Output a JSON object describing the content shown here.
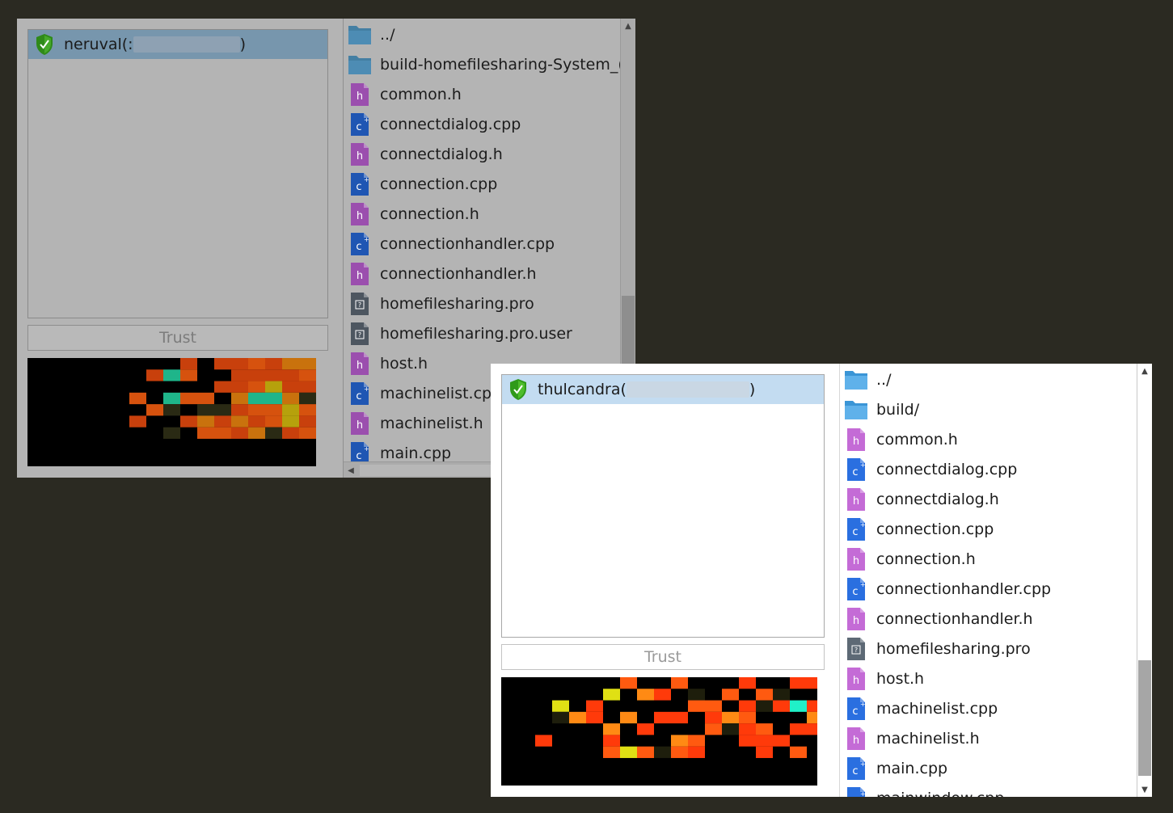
{
  "windows": [
    {
      "id": "back",
      "machine": {
        "name": "neruval",
        "prefix": " (:",
        "suffix": ")"
      },
      "trust_label": "Trust",
      "files": [
        {
          "name": "../",
          "type": "folder"
        },
        {
          "name": "build-homefilesharing-System_(",
          "type": "folder"
        },
        {
          "name": "common.h",
          "type": "header"
        },
        {
          "name": "connectdialog.cpp",
          "type": "cpp"
        },
        {
          "name": "connectdialog.h",
          "type": "header"
        },
        {
          "name": "connection.cpp",
          "type": "cpp"
        },
        {
          "name": "connection.h",
          "type": "header"
        },
        {
          "name": "connectionhandler.cpp",
          "type": "cpp"
        },
        {
          "name": "connectionhandler.h",
          "type": "header"
        },
        {
          "name": "homefilesharing.pro",
          "type": "pro"
        },
        {
          "name": "homefilesharing.pro.user",
          "type": "pro"
        },
        {
          "name": "host.h",
          "type": "header"
        },
        {
          "name": "machinelist.cpp",
          "type": "cpp"
        },
        {
          "name": "machinelist.h",
          "type": "header"
        },
        {
          "name": "main.cpp",
          "type": "cpp"
        }
      ]
    },
    {
      "id": "front",
      "machine": {
        "name": "thulcandra",
        "prefix": " (",
        "suffix": ")"
      },
      "trust_label": "Trust",
      "files": [
        {
          "name": "../",
          "type": "folder"
        },
        {
          "name": "build/",
          "type": "folder"
        },
        {
          "name": "common.h",
          "type": "header"
        },
        {
          "name": "connectdialog.cpp",
          "type": "cpp"
        },
        {
          "name": "connectdialog.h",
          "type": "header"
        },
        {
          "name": "connection.cpp",
          "type": "cpp"
        },
        {
          "name": "connection.h",
          "type": "header"
        },
        {
          "name": "connectionhandler.cpp",
          "type": "cpp"
        },
        {
          "name": "connectionhandler.h",
          "type": "header"
        },
        {
          "name": "homefilesharing.pro",
          "type": "pro"
        },
        {
          "name": "host.h",
          "type": "header"
        },
        {
          "name": "machinelist.cpp",
          "type": "cpp"
        },
        {
          "name": "machinelist.h",
          "type": "header"
        },
        {
          "name": "main.cpp",
          "type": "cpp"
        },
        {
          "name": "mainwindow.cpp",
          "type": "cpp"
        }
      ]
    }
  ],
  "icons": {
    "folder": "folder-icon",
    "header": "header-file-icon",
    "cpp": "cpp-file-icon",
    "pro": "project-file-icon",
    "shield": "shield-check-icon"
  },
  "colors": {
    "desktop": "#2b2a22",
    "folder": "#2e8fd0",
    "header": "#c46bd6",
    "cpp": "#2a6fe0",
    "pro": "#5d6975",
    "shield": "#3aa51f"
  }
}
